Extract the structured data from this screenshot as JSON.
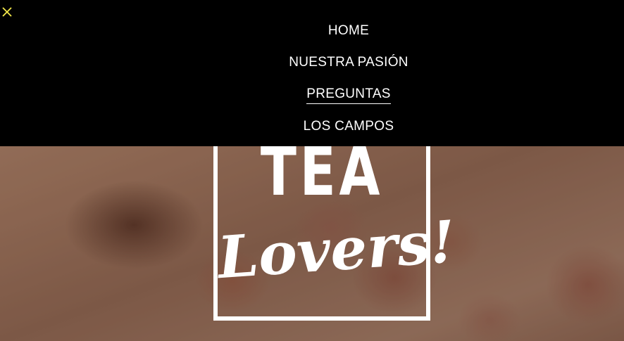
{
  "close_button": {
    "icon": "close-icon",
    "color": "#f5e94a"
  },
  "nav": {
    "items": [
      {
        "label": "HOME",
        "active": false
      },
      {
        "label": "NUESTRA PASIÓN",
        "active": false
      },
      {
        "label": "PREGUNTAS",
        "active": true
      },
      {
        "label": "LOS CAMPOS",
        "active": false
      }
    ],
    "background": "#000000",
    "text_color": "#ffffff"
  },
  "hero": {
    "logo": {
      "line1": "TEA",
      "line2": "Lovers!"
    }
  }
}
